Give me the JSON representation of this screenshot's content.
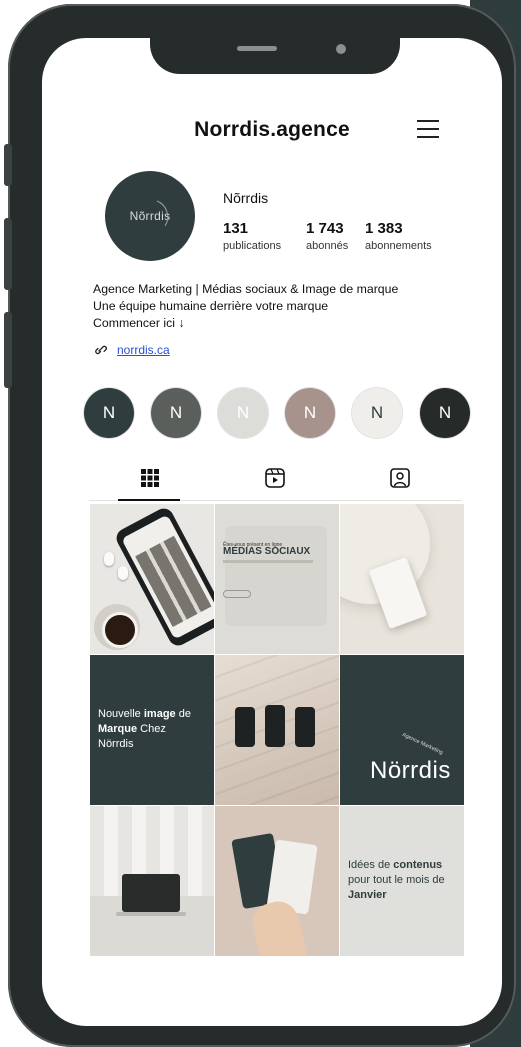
{
  "app": {
    "username": "Norrdis.agence",
    "display_name": "Nõrrdis",
    "avatar_text": "Nõrrdis"
  },
  "stats": [
    {
      "value": "131",
      "label": "publications"
    },
    {
      "value": "1 743",
      "label": "abonnés"
    },
    {
      "value": "1 383",
      "label": "abonnements"
    }
  ],
  "bio": {
    "line1": "Agence Marketing | Médias sociaux & Image de marque",
    "line2": "Une équipe humaine derrière votre marque",
    "line3": "Commencer ici ↓",
    "link": "norrdis.ca"
  },
  "highlights": [
    {
      "letter": "N",
      "bg": "#2f3d3e",
      "fg": "#ffffff"
    },
    {
      "letter": "N",
      "bg": "#5b5f5c",
      "fg": "#ffffff"
    },
    {
      "letter": "N",
      "bg": "#dcdcd8",
      "fg": "#ffffff"
    },
    {
      "letter": "N",
      "bg": "#a7928c",
      "fg": "#ffffff"
    },
    {
      "letter": "N",
      "bg": "#efeeea",
      "fg": "#2f3d3e"
    },
    {
      "letter": "N",
      "bg": "#262b2a",
      "fg": "#ffffff"
    }
  ],
  "tabs": [
    {
      "icon": "grid-icon",
      "active": true
    },
    {
      "icon": "reels-icon",
      "active": false
    },
    {
      "icon": "tagged-icon",
      "active": false
    }
  ],
  "posts": {
    "p2_small": "Êtes-vous présent en ligne",
    "p2_title": "MÉDIAS SOCIAUX",
    "p4_prefix": "Nouvelle ",
    "p4_bold1": "image",
    "p4_mid": " de ",
    "p4_bold2": "Marque",
    "p4_suffix": " Chez",
    "p4_last": "Nörrdis",
    "p6_logo": "Nörrdis",
    "p6_arc": "Agence Marketing",
    "p9_prefix": "Idées de ",
    "p9_bold1": "contenus",
    "p9_mid": "pour tout le mois de",
    "p9_bold2": "Janvier"
  },
  "colors": {
    "brand_dark": "#2f3d3e",
    "link": "#2a4fd6",
    "phone_frame": "#262b2c"
  }
}
